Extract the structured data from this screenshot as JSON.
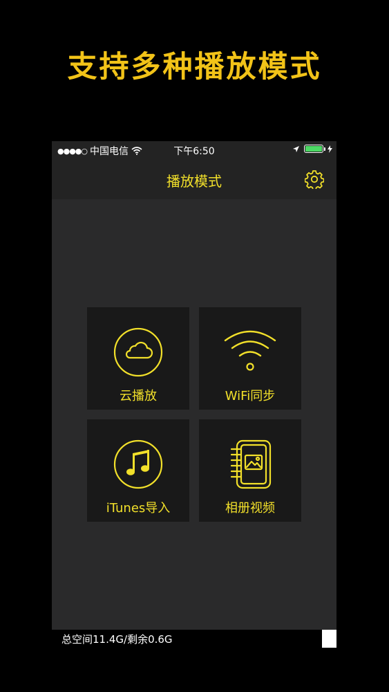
{
  "promo": {
    "title": "支持多种播放模式"
  },
  "status_bar": {
    "signal": "●●●●○",
    "carrier": "中国电信",
    "time": "下午6:50",
    "battery_level": 1.0
  },
  "nav": {
    "title": "播放模式"
  },
  "tiles": [
    {
      "label": "云播放",
      "icon": "cloud-icon"
    },
    {
      "label": "WiFi同步",
      "icon": "wifi-icon"
    },
    {
      "label": "iTunes导入",
      "icon": "music-note-icon"
    },
    {
      "label": "相册视频",
      "icon": "photo-album-icon"
    }
  ],
  "footer": {
    "storage": "总空间11.4G/剩余0.6G"
  },
  "colors": {
    "accent": "#f2e02a",
    "promo": "#f2c318",
    "battery": "#4cd964",
    "background": "#2a2a2b",
    "tile": "#191919"
  }
}
